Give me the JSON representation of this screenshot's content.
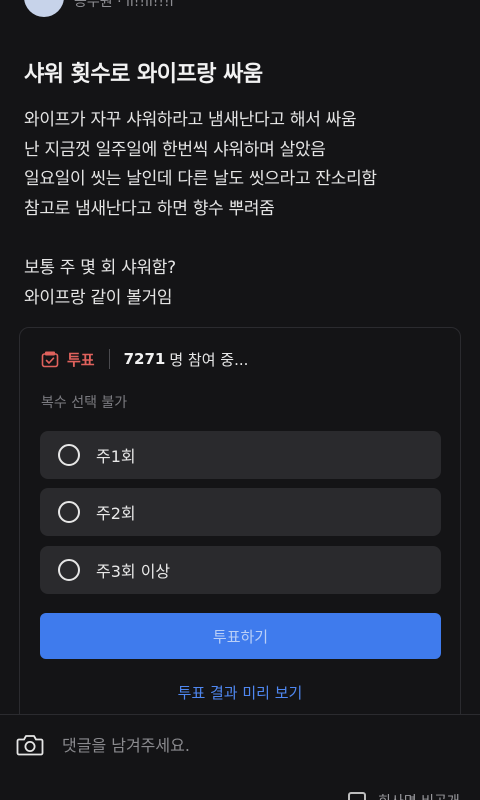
{
  "author": {
    "name": "공무원 · li!!li!!!l"
  },
  "post": {
    "title": "샤워 횟수로 와이프랑 싸움",
    "body": "와이프가 자꾸 샤워하라고 냄새난다고 해서 싸움\n난 지금껏 일주일에 한번씩 샤워하며 살았음\n일요일이 씻는 날인데 다른 날도 씻으라고 잔소리함\n참고로 냄새난다고 하면 향수 뿌려줌\n\n보통 주 몇 회 샤워함?\n와이프랑 같이 볼거임"
  },
  "poll": {
    "label": "투표",
    "count": "7271",
    "participants": "명 참여 중...",
    "rule": "복수 선택 불가",
    "options": [
      {
        "label": "주1회"
      },
      {
        "label": "주2회"
      },
      {
        "label": "주3회 이상"
      }
    ],
    "vote_button": "투표하기",
    "preview_link": "투표 결과 미리 보기"
  },
  "comment": {
    "placeholder": "댓글을 남겨주세요.",
    "anonymous_label": "회사명 비공개"
  },
  "colors": {
    "background": "#141416",
    "accent": "#3f7bed",
    "poll_red": "#e0625d",
    "link_blue": "#4f87f0"
  }
}
